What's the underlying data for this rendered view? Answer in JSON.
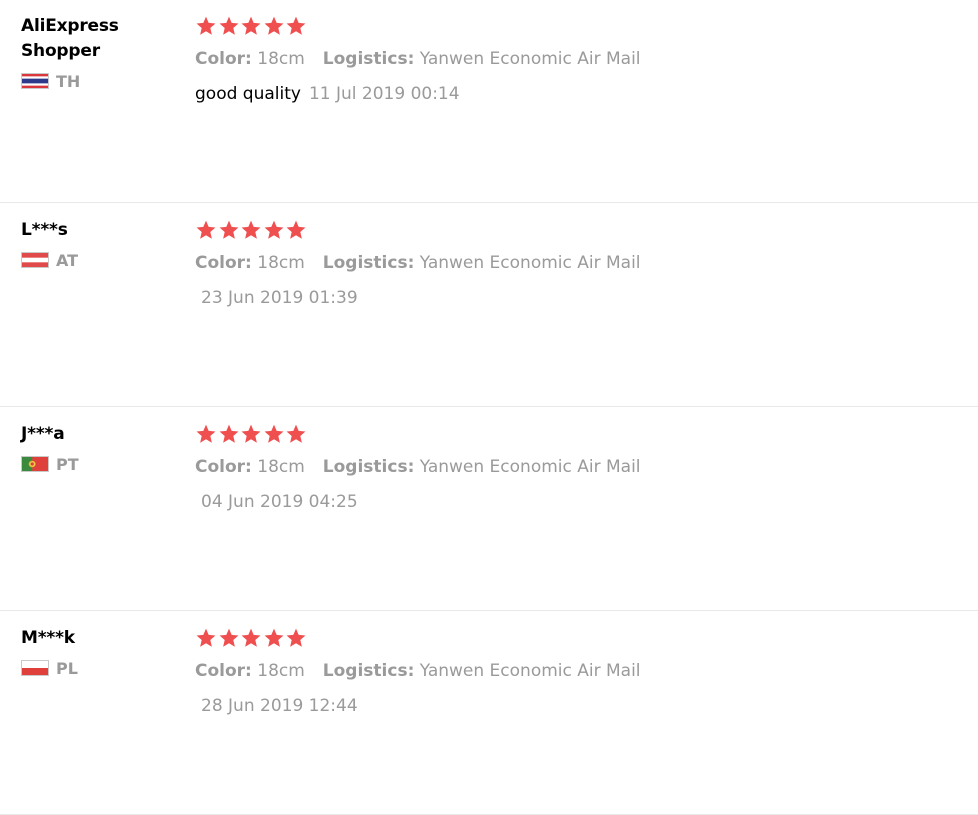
{
  "colors": {
    "star": "#ef4f4f",
    "muted": "#9a9a9a",
    "text": "#000000",
    "divider": "#e9e9e9"
  },
  "reviews": [
    {
      "name_lines": [
        "AliExpress",
        "Shopper"
      ],
      "country": "TH",
      "flag": "flag-th",
      "stars": 5,
      "color_label": "Color:",
      "color_value": "18cm",
      "logistics_label": "Logistics:",
      "logistics_value": "Yanwen Economic Air Mail",
      "text": "good quality",
      "date": "11 Jul 2019 00:14"
    },
    {
      "name_lines": [
        "L***s"
      ],
      "country": "AT",
      "flag": "flag-at",
      "stars": 5,
      "color_label": "Color:",
      "color_value": "18cm",
      "logistics_label": "Logistics:",
      "logistics_value": "Yanwen Economic Air Mail",
      "text": "",
      "date": "23 Jun 2019 01:39"
    },
    {
      "name_lines": [
        "J***a"
      ],
      "country": "PT",
      "flag": "flag-pt",
      "stars": 5,
      "color_label": "Color:",
      "color_value": "18cm",
      "logistics_label": "Logistics:",
      "logistics_value": "Yanwen Economic Air Mail",
      "text": "",
      "date": "04 Jun 2019 04:25"
    },
    {
      "name_lines": [
        "M***k"
      ],
      "country": "PL",
      "flag": "flag-pl",
      "stars": 5,
      "color_label": "Color:",
      "color_value": "18cm",
      "logistics_label": "Logistics:",
      "logistics_value": "Yanwen Economic Air Mail",
      "text": "",
      "date": "28 Jun 2019 12:44"
    }
  ]
}
